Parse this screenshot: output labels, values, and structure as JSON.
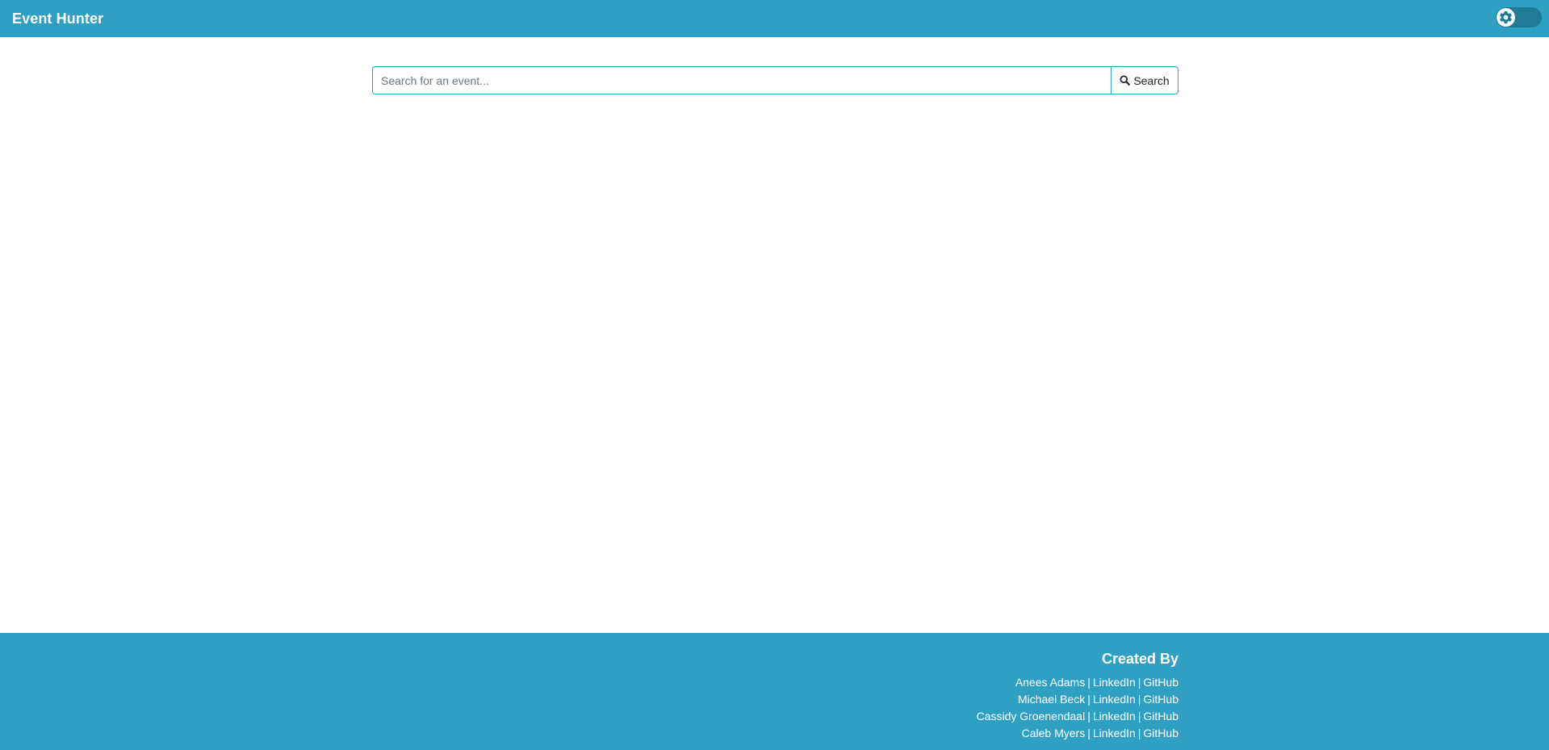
{
  "header": {
    "title": "Event Hunter",
    "theme_toggle_icon": "gear-icon",
    "theme_toggle_state": "off"
  },
  "search": {
    "placeholder": "Search for an event...",
    "value": "",
    "button_label": "Search",
    "button_icon": "search-icon"
  },
  "footer": {
    "heading": "Created By",
    "separator": "|",
    "credits": [
      {
        "name": "Anees Adams",
        "linkedin": "LinkedIn",
        "github": "GitHub"
      },
      {
        "name": "Michael Beck",
        "linkedin": "LinkedIn",
        "github": "GitHub"
      },
      {
        "name": "Cassidy Groenendaal",
        "linkedin": "LinkedIn",
        "github": "GitHub"
      },
      {
        "name": "Caleb Myers",
        "linkedin": "LinkedIn",
        "github": "GitHub"
      }
    ]
  },
  "colors": {
    "brand": "#2fa0c3",
    "toggle_track": "#1e7a96"
  }
}
